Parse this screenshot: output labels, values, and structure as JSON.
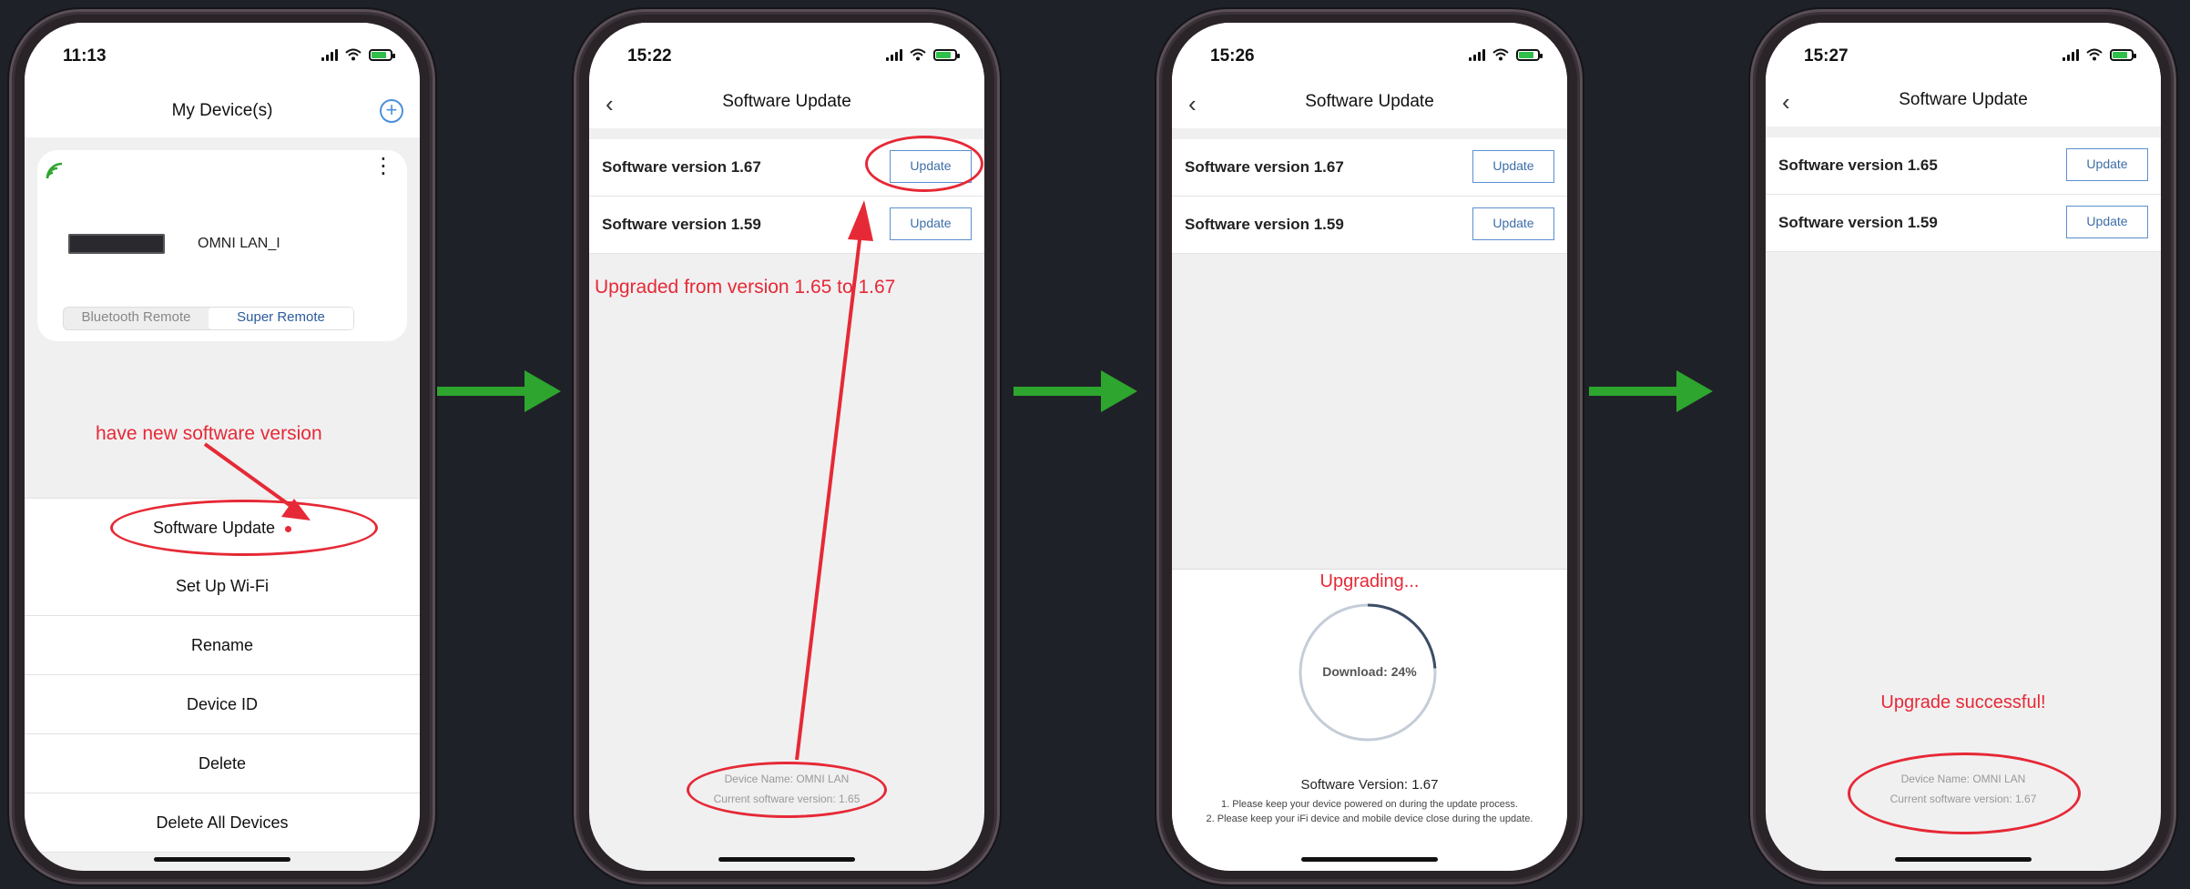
{
  "screens": [
    {
      "time": "11:13",
      "title": "My Device(s)",
      "device_name": "OMNI LAN_I",
      "segment": [
        "Bluetooth Remote",
        "Super Remote"
      ],
      "annotation": "have new software version",
      "menu": [
        "Software Update",
        "Set Up Wi-Fi",
        "Rename",
        "Device ID",
        "Delete",
        "Delete All Devices"
      ]
    },
    {
      "time": "15:22",
      "title": "Software Update",
      "rows": [
        {
          "label": "Software version 1.67",
          "button": "Update"
        },
        {
          "label": "Software version 1.59",
          "button": "Update"
        }
      ],
      "annotation": "Upgraded from version 1.65 to 1.67",
      "device_info": "Device Name: OMNI LAN",
      "current_version": "Current software version: 1.65"
    },
    {
      "time": "15:26",
      "title": "Software Update",
      "rows": [
        {
          "label": "Software version 1.67",
          "button": "Update"
        },
        {
          "label": "Software version 1.59",
          "button": "Update"
        }
      ],
      "upgrading": "Upgrading...",
      "download": "Download: 24%",
      "download_progress": 0.24,
      "version_line": "Software Version: 1.67",
      "note1": "1. Please keep your device powered on during the update process.",
      "note2": "2. Please keep your iFi device and mobile device close during the update."
    },
    {
      "time": "15:27",
      "title": "Software Update",
      "rows": [
        {
          "label": "Software version 1.65",
          "button": "Update"
        },
        {
          "label": "Software version 1.59",
          "button": "Update"
        }
      ],
      "success": "Upgrade successful!",
      "device_info": "Device Name: OMNI LAN",
      "current_version": "Current software version: 1.67"
    }
  ],
  "colors": {
    "accent_red": "#e62936",
    "arrow_green": "#2ea52e",
    "button_blue": "#5b8fd0"
  }
}
